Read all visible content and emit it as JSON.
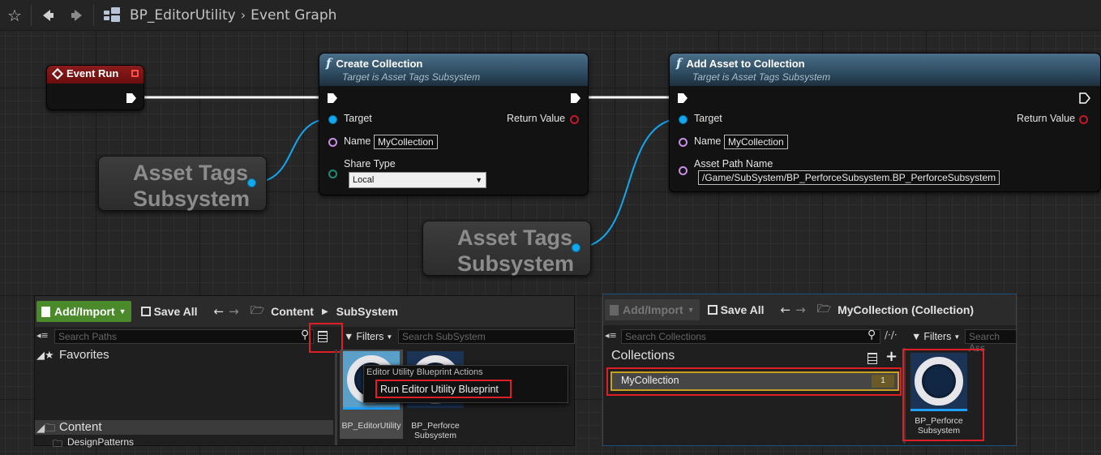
{
  "breadcrumb": {
    "asset": "BP_EditorUtility",
    "graph": "Event Graph"
  },
  "icons": {
    "star": "star-icon",
    "back": "arrow-left-icon",
    "forward": "arrow-right-icon",
    "blueprint": "blueprint-graph-icon"
  },
  "nodes": {
    "event_run": {
      "title": "Event Run"
    },
    "create_collection": {
      "title": "Create Collection",
      "subtitle": "Target is Asset Tags Subsystem",
      "pin_target": "Target",
      "pin_return": "Return Value",
      "pin_name": "Name",
      "name_value": "MyCollection",
      "pin_share": "Share Type",
      "share_value": "Local"
    },
    "add_asset": {
      "title": "Add Asset to Collection",
      "subtitle": "Target is Asset Tags Subsystem",
      "pin_target": "Target",
      "pin_return": "Return Value",
      "pin_name": "Name",
      "name_value": "MyCollection",
      "pin_path": "Asset Path Name",
      "path_value": "/Game/SubSystem/BP_PerforceSubsystem.BP_PerforceSubsystem"
    },
    "getter1": {
      "line1": "Asset Tags",
      "line2": "Subsystem"
    },
    "getter2": {
      "line1": "Asset Tags",
      "line2": "Subsystem"
    }
  },
  "content_browser": {
    "add_import": "Add/Import",
    "save_all": "Save All",
    "path_root": "Content",
    "path_leaf": "SubSystem",
    "search_paths_placeholder": "Search Paths",
    "filters": "Filters",
    "search_assets_placeholder": "Search SubSystem",
    "favorites": "Favorites",
    "content_folder": "Content",
    "design_patterns": "DesignPatterns",
    "context_menu_header": "Editor Utility Blueprint Actions",
    "context_menu_item": "Run Editor Utility Blueprint",
    "asset1_label": "BP_EditorUtility",
    "asset2_label_line1": "BP_Perforce",
    "asset2_label_line2": "Subsystem"
  },
  "collection_browser": {
    "add_import": "Add/Import",
    "save_all": "Save All",
    "path": "MyCollection (Collection)",
    "search_collections_placeholder": "Search Collections",
    "filters": "Filters",
    "search_assets_placeholder": "Search Ass",
    "collections_header": "Collections",
    "collection_name": "MyCollection",
    "collection_count": "1",
    "asset_label_line1": "BP_Perforce",
    "asset_label_line2": "Subsystem"
  }
}
